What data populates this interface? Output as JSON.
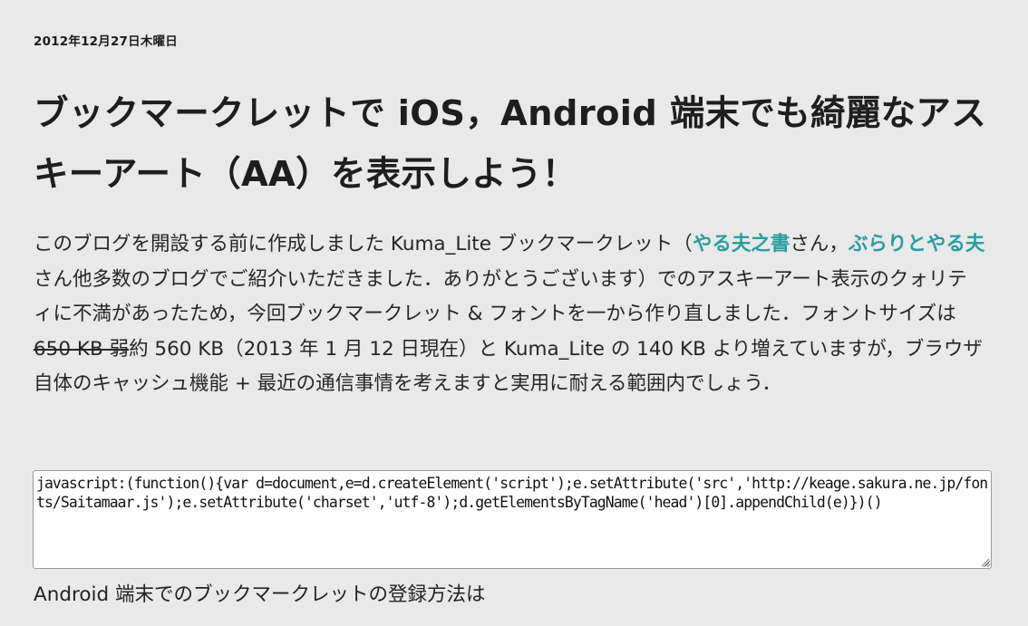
{
  "post": {
    "date": "2012年12月27日木曜日",
    "title": "ブックマークレットで iOS，Android 端末でも綺麗なアスキーアート（AA）を表示しよう！",
    "body": {
      "p1_a": "このブログを開設する前に作成しました Kuma_Lite ブックマークレット（",
      "link1": "やる夫之書",
      "p1_b": "さん，",
      "link2": "ぶらりとやる夫",
      "p1_c": "さん他多数のブログでご紹介いただきました．ありがとうございます）でのアスキーアート表示のクォリティに不満があったため，今回ブックマークレット & フォントを一から作り直しました．フォントサイズは ",
      "struck": "650 KB 弱",
      "p1_d": "約 560 KB（2013 年 1 月 12 日現在）と Kuma_Lite の 140 KB より増えていますが，ブラウザ自体のキャッシュ機能 + 最近の通信事情を考えますと実用に耐える範囲内でしょう．"
    },
    "code": "javascript:(function(){var d=document,e=d.createElement('script');e.setAttribute('src','http://keage.sakura.ne.jp/fonts/Saitamaar.js');e.setAttribute('charset','utf-8');d.getElementsByTagName('head')[0].appendChild(e)})()",
    "after_text": "Android 端末でのブックマークレットの登録方法は"
  },
  "colors": {
    "background": "#e9e9e9",
    "link": "#2a9d9f",
    "text": "#1f1f1f"
  },
  "icons": {
    "resize_grip": "resize-grip-icon"
  }
}
